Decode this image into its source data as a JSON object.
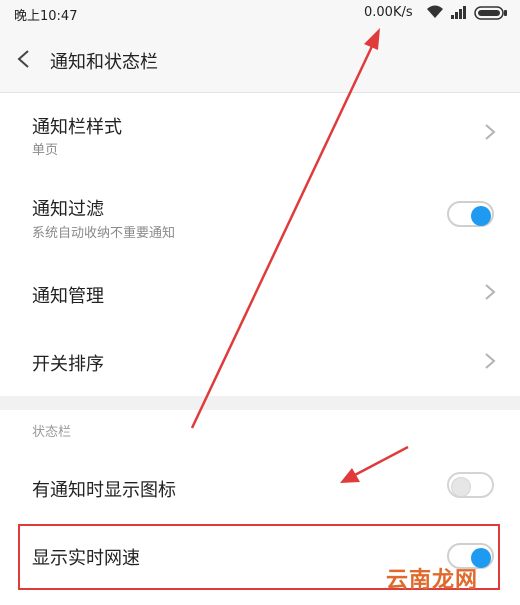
{
  "status_bar": {
    "time": "晚上10:47",
    "net_speed": "0.00K/s",
    "icons": [
      "wifi-icon",
      "signal-icon",
      "battery-icon"
    ]
  },
  "header": {
    "back_icon": "chevron-left-icon",
    "title": "通知和状态栏"
  },
  "notification_section": {
    "items": [
      {
        "label": "通知栏样式",
        "sub": "单页",
        "control": "chevron-right-icon"
      },
      {
        "label": "通知过滤",
        "sub": "系统自动收纳不重要通知",
        "control": "toggle",
        "toggle_on": true
      },
      {
        "label": "通知管理",
        "control": "chevron-right-icon"
      },
      {
        "label": "开关排序",
        "control": "chevron-right-icon"
      }
    ]
  },
  "status_bar_section": {
    "header": "状态栏",
    "items": [
      {
        "label": "有通知时显示图标",
        "control": "toggle",
        "toggle_on": false
      },
      {
        "label": "显示实时网速",
        "control": "toggle",
        "toggle_on": true
      }
    ]
  },
  "annotations": {
    "highlight_color": "#e03b3b",
    "arrow_color": "#e03b3b",
    "toggle_on_color": "#1e9bf0"
  },
  "watermark": "云南龙网"
}
